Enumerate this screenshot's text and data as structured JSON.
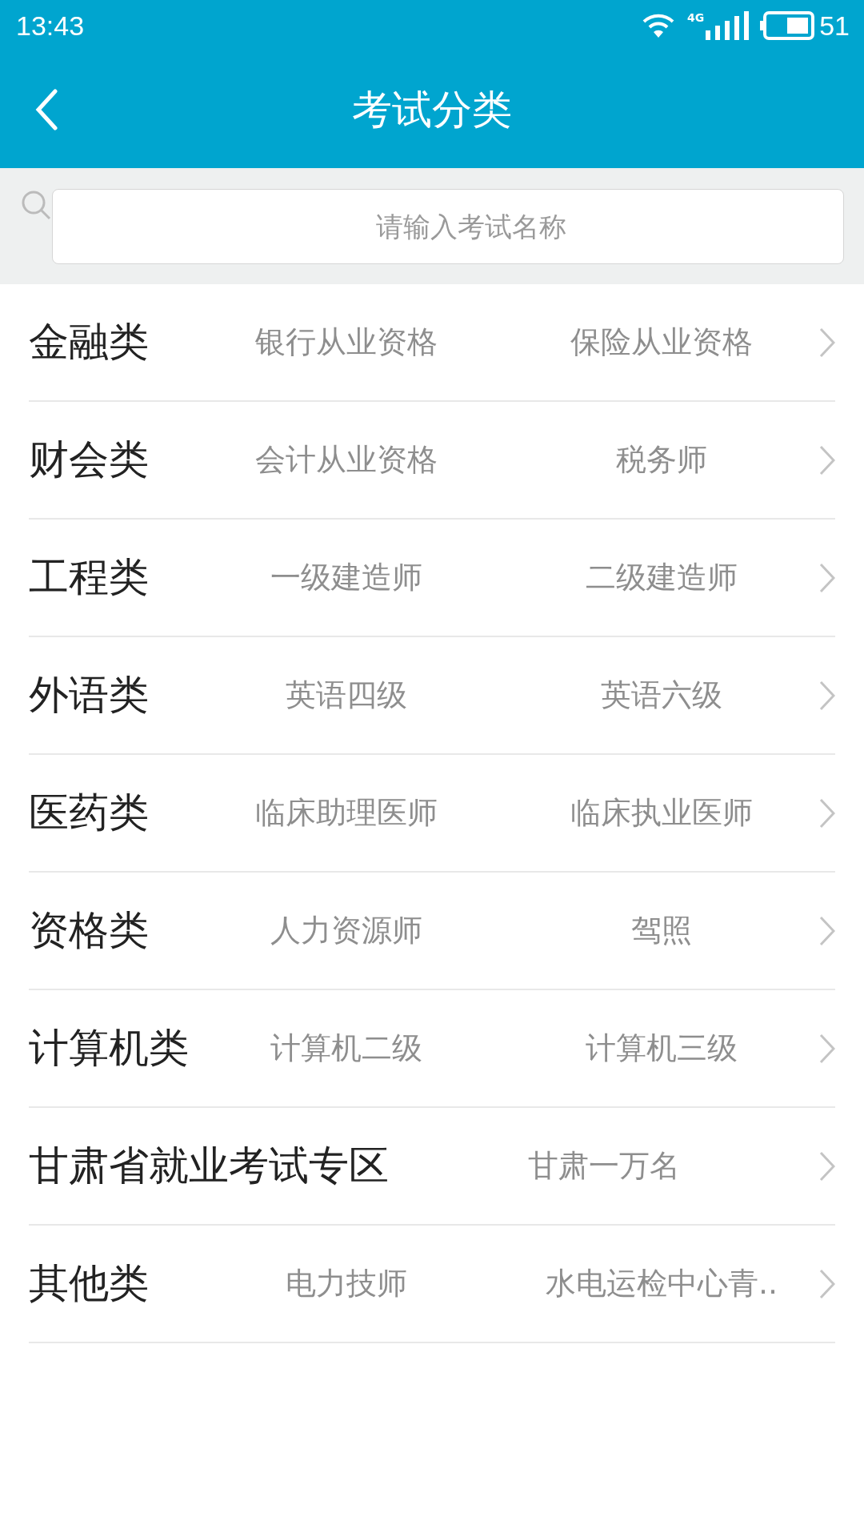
{
  "status_bar": {
    "time": "13:43",
    "network": "4G",
    "battery": "51"
  },
  "header": {
    "title": "考试分类"
  },
  "search": {
    "placeholder": "请输入考试名称"
  },
  "categories": [
    {
      "name": "金融类",
      "items": [
        "银行从业资格",
        "保险从业资格"
      ]
    },
    {
      "name": "财会类",
      "items": [
        "会计从业资格",
        "税务师"
      ]
    },
    {
      "name": "工程类",
      "items": [
        "一级建造师",
        "二级建造师"
      ]
    },
    {
      "name": "外语类",
      "items": [
        "英语四级",
        "英语六级"
      ]
    },
    {
      "name": "医药类",
      "items": [
        "临床助理医师",
        "临床执业医师"
      ]
    },
    {
      "name": "资格类",
      "items": [
        "人力资源师",
        "驾照"
      ]
    },
    {
      "name": "计算机类",
      "items": [
        "计算机二级",
        "计算机三级"
      ]
    },
    {
      "name": "甘肃省就业考试专区",
      "items": [
        "甘肃一万名"
      ]
    },
    {
      "name": "其他类",
      "items": [
        "电力技师",
        "水电运检中心青.."
      ]
    }
  ]
}
